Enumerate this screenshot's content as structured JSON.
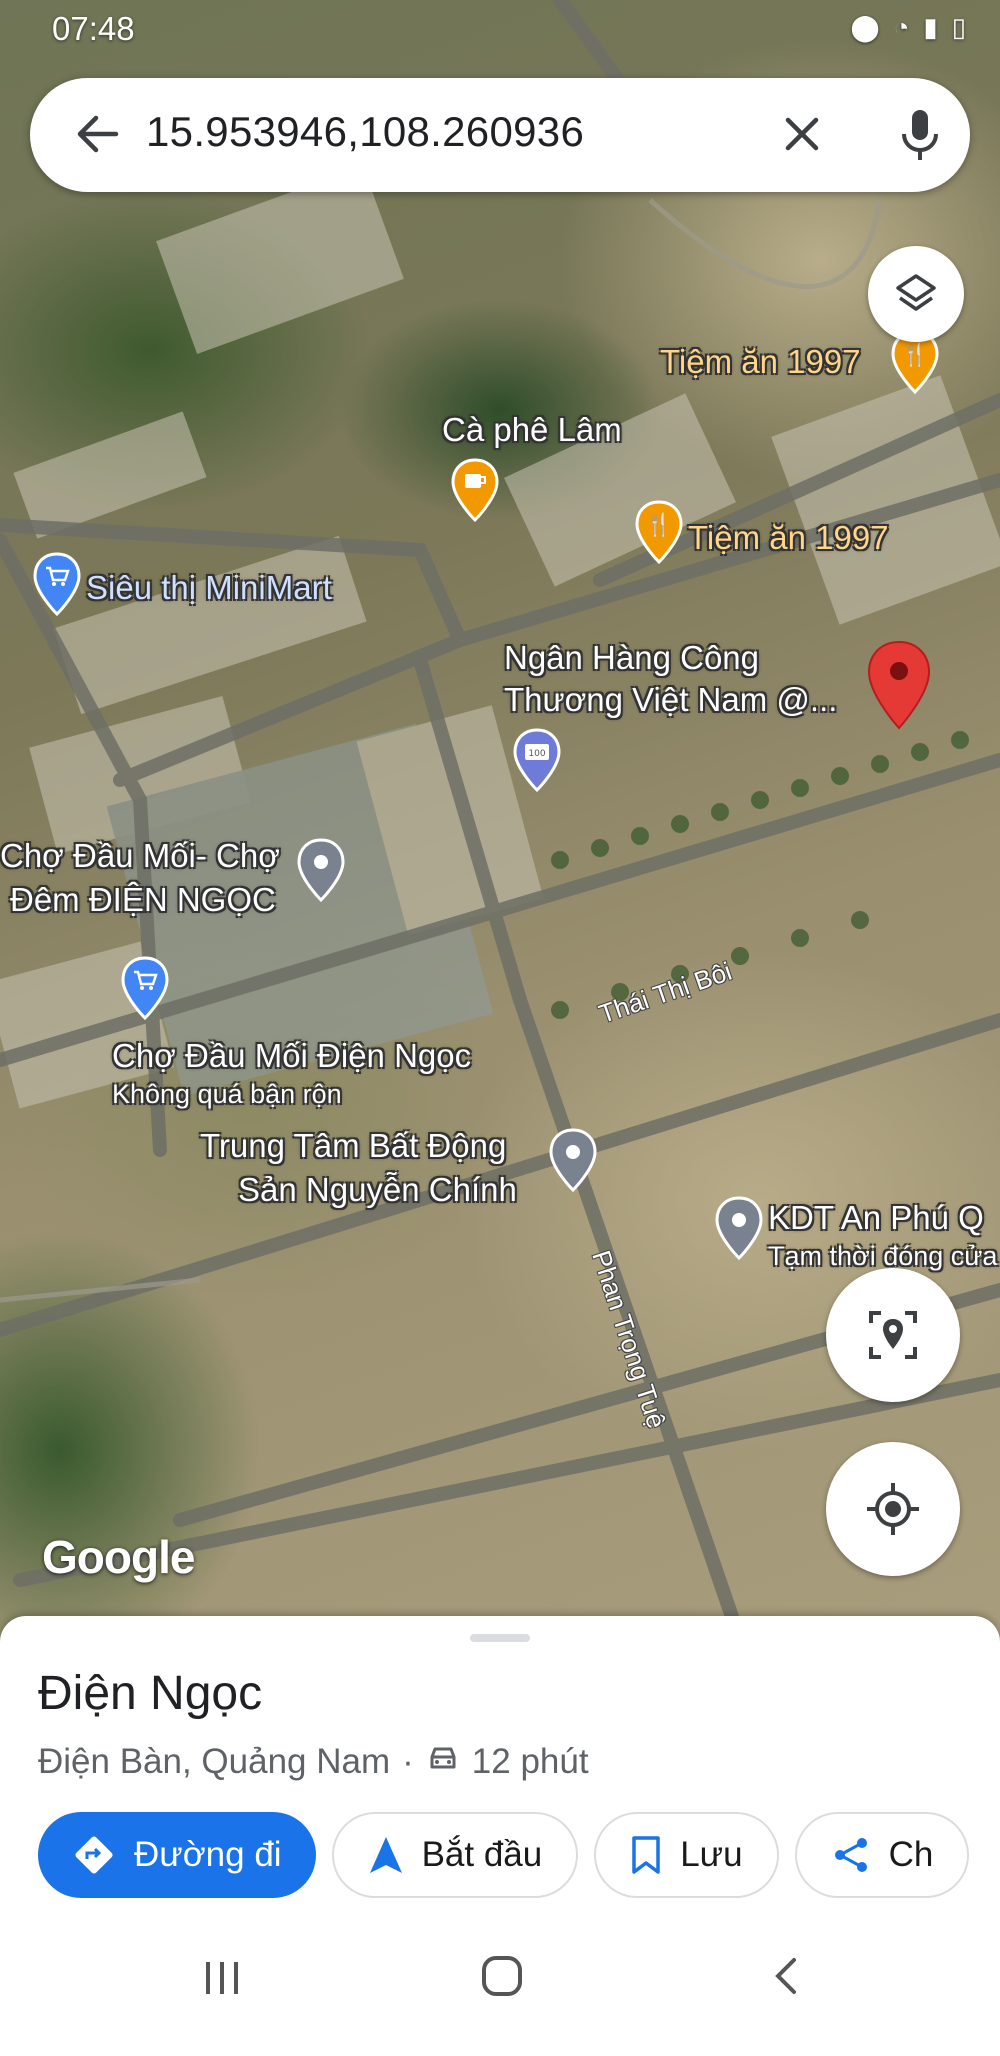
{
  "status_bar": {
    "time": "07:48"
  },
  "search": {
    "query": "15.953946,108.260936"
  },
  "map": {
    "pois": [
      {
        "name": "Tiệm ăn 1997",
        "category": "restaurant"
      },
      {
        "name": "Cà phê Lâm",
        "category": "cafe"
      },
      {
        "name": "Tiệm ăn 1997",
        "category": "restaurant"
      },
      {
        "name": "Siêu thị MiniMart",
        "category": "shopping"
      },
      {
        "name_line1": "Ngân Hàng Công",
        "name_line2": "Thương Việt Nam @...",
        "category": "bank"
      },
      {
        "name_line1": "Chợ Đầu Mối- Chợ",
        "name_line2": "Đêm ĐIỆN NGỌC",
        "category": "place"
      },
      {
        "name": "Chợ Đầu Mối Điện Ngọc",
        "status": "Không quá bận rộn",
        "category": "shopping"
      },
      {
        "name_line1": "Trung Tâm Bất Động",
        "name_line2": "Sản Nguyễn Chính",
        "category": "place"
      },
      {
        "name": "KDT An Phú Q",
        "status": "Tạm thời đóng cửa",
        "category": "place"
      }
    ],
    "roads": [
      "Thái Thị Bôi",
      "Phan Trọng Tuệ"
    ],
    "attribution": "Google"
  },
  "place": {
    "title": "Điện Ngọc",
    "region": "Điện Bàn, Quảng Nam",
    "separator": "·",
    "drive_time": "12 phút"
  },
  "actions": {
    "directions": "Đường đi",
    "start": "Bắt đầu",
    "save": "Lưu",
    "share": "Ch"
  },
  "colors": {
    "primary": "#1a73e8",
    "marker_red": "#e53935",
    "food_pin": "#f29900",
    "shop_pin": "#4285f4",
    "generic_pin": "#7a8290"
  }
}
